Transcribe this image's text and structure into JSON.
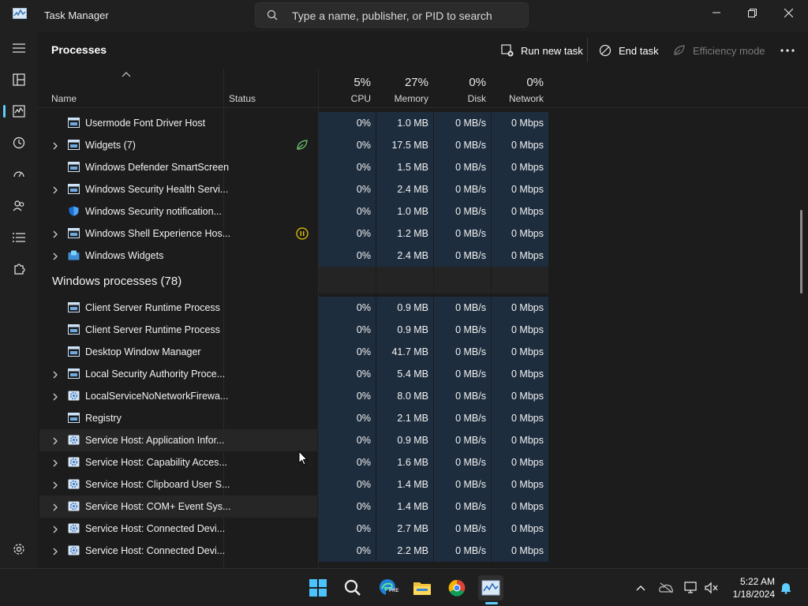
{
  "window": {
    "title": "Task Manager"
  },
  "search": {
    "placeholder": "Type a name, publisher, or PID to search"
  },
  "page": {
    "title": "Processes"
  },
  "toolbar": {
    "run_new_task": "Run new task",
    "end_task": "End task",
    "efficiency_mode": "Efficiency mode"
  },
  "columns": {
    "name": "Name",
    "status": "Status",
    "cpu": {
      "pct": "5%",
      "label": "CPU"
    },
    "memory": {
      "pct": "27%",
      "label": "Memory"
    },
    "disk": {
      "pct": "0%",
      "label": "Disk"
    },
    "network": {
      "pct": "0%",
      "label": "Network"
    }
  },
  "processes_top": [
    {
      "name": "Usermode Font Driver Host",
      "expandable": false,
      "icon": "window-icon",
      "status_icon": "",
      "cpu": "0%",
      "memory": "1.0 MB",
      "disk": "0 MB/s",
      "network": "0 Mbps"
    },
    {
      "name": "Widgets (7)",
      "expandable": true,
      "icon": "window-icon",
      "status_icon": "leaf-icon",
      "cpu": "0%",
      "memory": "17.5 MB",
      "disk": "0 MB/s",
      "network": "0 Mbps"
    },
    {
      "name": "Windows Defender SmartScreen",
      "expandable": false,
      "icon": "window-icon",
      "status_icon": "",
      "cpu": "0%",
      "memory": "1.5 MB",
      "disk": "0 MB/s",
      "network": "0 Mbps"
    },
    {
      "name": "Windows Security Health Servi...",
      "expandable": true,
      "icon": "window-icon",
      "status_icon": "",
      "cpu": "0%",
      "memory": "2.4 MB",
      "disk": "0 MB/s",
      "network": "0 Mbps"
    },
    {
      "name": "Windows Security notification...",
      "expandable": false,
      "icon": "shield-icon",
      "status_icon": "",
      "cpu": "0%",
      "memory": "1.0 MB",
      "disk": "0 MB/s",
      "network": "0 Mbps"
    },
    {
      "name": "Windows Shell Experience Hos...",
      "expandable": true,
      "icon": "window-icon",
      "status_icon": "pause-icon",
      "cpu": "0%",
      "memory": "1.2 MB",
      "disk": "0 MB/s",
      "network": "0 Mbps"
    },
    {
      "name": "Windows Widgets",
      "expandable": true,
      "icon": "widgets-icon",
      "status_icon": "",
      "cpu": "0%",
      "memory": "2.4 MB",
      "disk": "0 MB/s",
      "network": "0 Mbps"
    }
  ],
  "group": {
    "title": "Windows processes (78)"
  },
  "processes_windows": [
    {
      "name": "Client Server Runtime Process",
      "expandable": false,
      "icon": "window-icon",
      "cpu": "0%",
      "memory": "0.9 MB",
      "disk": "0 MB/s",
      "network": "0 Mbps"
    },
    {
      "name": "Client Server Runtime Process",
      "expandable": false,
      "icon": "window-icon",
      "cpu": "0%",
      "memory": "0.9 MB",
      "disk": "0 MB/s",
      "network": "0 Mbps"
    },
    {
      "name": "Desktop Window Manager",
      "expandable": false,
      "icon": "window-icon",
      "cpu": "0%",
      "memory": "41.7 MB",
      "disk": "0 MB/s",
      "network": "0 Mbps"
    },
    {
      "name": "Local Security Authority Proce...",
      "expandable": true,
      "icon": "window-icon",
      "cpu": "0%",
      "memory": "5.4 MB",
      "disk": "0 MB/s",
      "network": "0 Mbps"
    },
    {
      "name": "LocalServiceNoNetworkFirewa...",
      "expandable": true,
      "icon": "gear-icon",
      "cpu": "0%",
      "memory": "8.0 MB",
      "disk": "0 MB/s",
      "network": "0 Mbps"
    },
    {
      "name": "Registry",
      "expandable": false,
      "icon": "window-icon",
      "cpu": "0%",
      "memory": "2.1 MB",
      "disk": "0 MB/s",
      "network": "0 Mbps"
    },
    {
      "name": "Service Host: Application Infor...",
      "expandable": true,
      "icon": "gear-icon",
      "cpu": "0%",
      "memory": "0.9 MB",
      "disk": "0 MB/s",
      "network": "0 Mbps"
    },
    {
      "name": "Service Host: Capability Acces...",
      "expandable": true,
      "icon": "gear-icon",
      "cpu": "0%",
      "memory": "1.6 MB",
      "disk": "0 MB/s",
      "network": "0 Mbps"
    },
    {
      "name": "Service Host: Clipboard User S...",
      "expandable": true,
      "icon": "gear-icon",
      "cpu": "0%",
      "memory": "1.4 MB",
      "disk": "0 MB/s",
      "network": "0 Mbps"
    },
    {
      "name": "Service Host: COM+ Event Sys...",
      "expandable": true,
      "icon": "gear-icon",
      "cpu": "0%",
      "memory": "1.4 MB",
      "disk": "0 MB/s",
      "network": "0 Mbps"
    },
    {
      "name": "Service Host: Connected Devi...",
      "expandable": true,
      "icon": "gear-icon",
      "cpu": "0%",
      "memory": "2.7 MB",
      "disk": "0 MB/s",
      "network": "0 Mbps"
    },
    {
      "name": "Service Host: Connected Devi...",
      "expandable": true,
      "icon": "gear-icon",
      "cpu": "0%",
      "memory": "2.2 MB",
      "disk": "0 MB/s",
      "network": "0 Mbps"
    }
  ],
  "taskbar": {
    "clock_time": "5:22 AM",
    "clock_date": "1/18/2024",
    "edge_badge": "PRE"
  },
  "colors": {
    "accent": "#60cdff",
    "heat_cell": "#1e2d3e",
    "background": "#1c1c1c"
  }
}
